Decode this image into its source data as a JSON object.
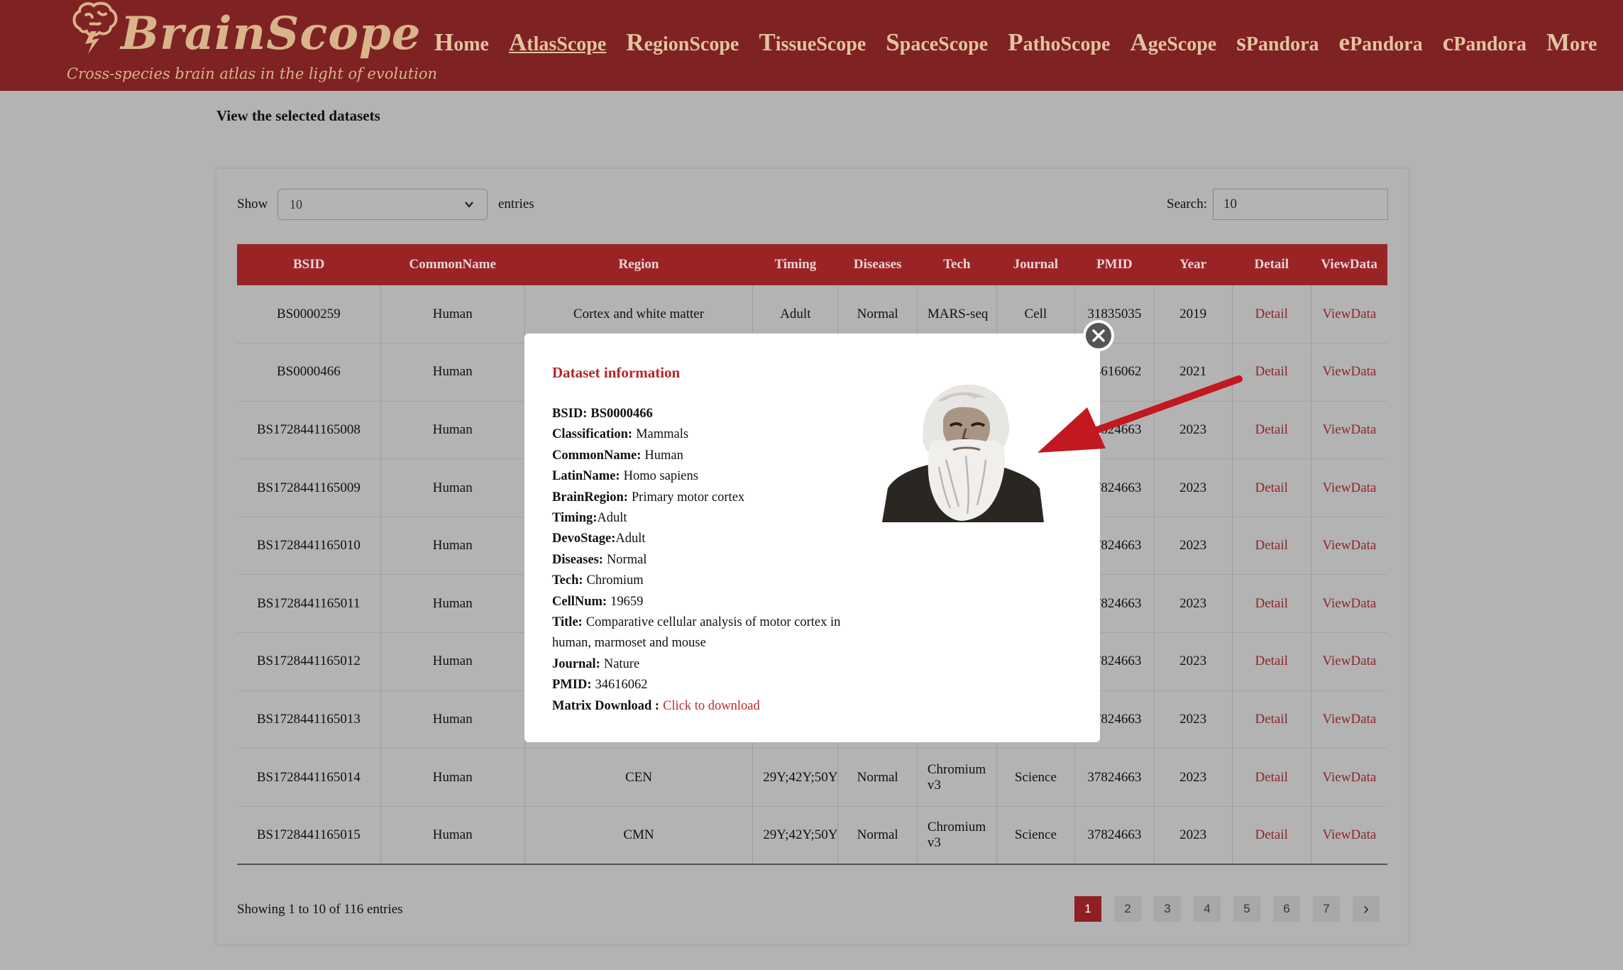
{
  "header": {
    "logo_title": "BrainScope",
    "logo_tagline": "Cross-species brain atlas in the light of evolution",
    "nav": [
      {
        "cap": "H",
        "rest": "ome"
      },
      {
        "cap": "A",
        "rest": "tlasScope"
      },
      {
        "cap": "R",
        "rest": "egionScope"
      },
      {
        "cap": "T",
        "rest": "issueScope"
      },
      {
        "cap": "S",
        "rest": "paceScope"
      },
      {
        "cap": "P",
        "rest": "athoScope"
      },
      {
        "cap": "A",
        "rest": "geScope"
      },
      {
        "cap": "s",
        "rest": "Pandora"
      },
      {
        "cap": "e",
        "rest": "Pandora"
      },
      {
        "cap": "c",
        "rest": "Pandora"
      },
      {
        "cap": "M",
        "rest": "ore"
      }
    ],
    "active_nav_index": 1,
    "colors": {
      "bar": "#7e2224",
      "text": "#e3c39f"
    }
  },
  "page_heading": "View the selected datasets",
  "controls": {
    "show_label": "Show",
    "show_value": "10",
    "entries_label": "entries",
    "search_label": "Search:",
    "search_value": "10"
  },
  "table": {
    "columns": [
      "BSID",
      "CommonName",
      "Region",
      "Timing",
      "Diseases",
      "Tech",
      "Journal",
      "PMID",
      "Year",
      "Detail",
      "ViewData"
    ],
    "rows": [
      [
        "BS0000259",
        "Human",
        "Cortex and white matter",
        "Adult",
        "Normal",
        "MARS-seq",
        "Cell",
        "31835035",
        "2019",
        "Detail",
        "ViewData"
      ],
      [
        "BS0000466",
        "Human",
        "",
        "",
        "",
        "",
        "",
        "34616062",
        "2021",
        "Detail",
        "ViewData"
      ],
      [
        "BS1728441165008",
        "Human",
        "",
        "",
        "",
        "",
        "",
        "37824663",
        "2023",
        "Detail",
        "ViewData"
      ],
      [
        "BS1728441165009",
        "Human",
        "",
        "",
        "",
        "",
        "",
        "37824663",
        "2023",
        "Detail",
        "ViewData"
      ],
      [
        "BS1728441165010",
        "Human",
        "",
        "",
        "",
        "",
        "",
        "37824663",
        "2023",
        "Detail",
        "ViewData"
      ],
      [
        "BS1728441165011",
        "Human",
        "",
        "",
        "",
        "",
        "",
        "37824663",
        "2023",
        "Detail",
        "ViewData"
      ],
      [
        "BS1728441165012",
        "Human",
        "",
        "",
        "",
        "",
        "",
        "37824663",
        "2023",
        "Detail",
        "ViewData"
      ],
      [
        "BS1728441165013",
        "Human",
        "",
        "",
        "",
        "",
        "",
        "37824663",
        "2023",
        "Detail",
        "ViewData"
      ],
      [
        "BS1728441165014",
        "Human",
        "CEN",
        "29Y;42Y;50Y",
        "Normal",
        "Chromium v3",
        "Science",
        "37824663",
        "2023",
        "Detail",
        "ViewData"
      ],
      [
        "BS1728441165015",
        "Human",
        "CMN",
        "29Y;42Y;50Y",
        "Normal",
        "Chromium v3",
        "Science",
        "37824663",
        "2023",
        "Detail",
        "ViewData"
      ]
    ]
  },
  "footer": {
    "showing_text": "Showing 1 to 10 of 116 entries",
    "pages": [
      "1",
      "2",
      "3",
      "4",
      "5",
      "6",
      "7"
    ],
    "current_page": "1",
    "next_symbol": "›"
  },
  "modal": {
    "title": "Dataset information",
    "fields": [
      {
        "label": "BSID:",
        "value": "BS0000466",
        "bold_value": true
      },
      {
        "label": "Classification:",
        "value": "Mammals"
      },
      {
        "label": "CommonName:",
        "value": "Human"
      },
      {
        "label": "LatinName:",
        "value": "Homo sapiens"
      },
      {
        "label": "BrainRegion:",
        "value": "Primary motor cortex"
      },
      {
        "label": "Timing:",
        "value": "Adult"
      },
      {
        "label": "DevoStage:",
        "value": "Adult"
      },
      {
        "label": "Diseases:",
        "value": "Normal"
      },
      {
        "label": "Tech:",
        "value": "Chromium"
      },
      {
        "label": "CellNum:",
        "value": "19659"
      },
      {
        "label": "Title:",
        "value": "Comparative cellular analysis of motor cortex in human, marmoset and mouse"
      },
      {
        "label": "Journal:",
        "value": "Nature"
      },
      {
        "label": "PMID:",
        "value": "34616062"
      }
    ],
    "download_label": "Matrix Download :",
    "download_link": "Click to download",
    "close_icon": "close-icon",
    "accent": "#b5262a"
  }
}
